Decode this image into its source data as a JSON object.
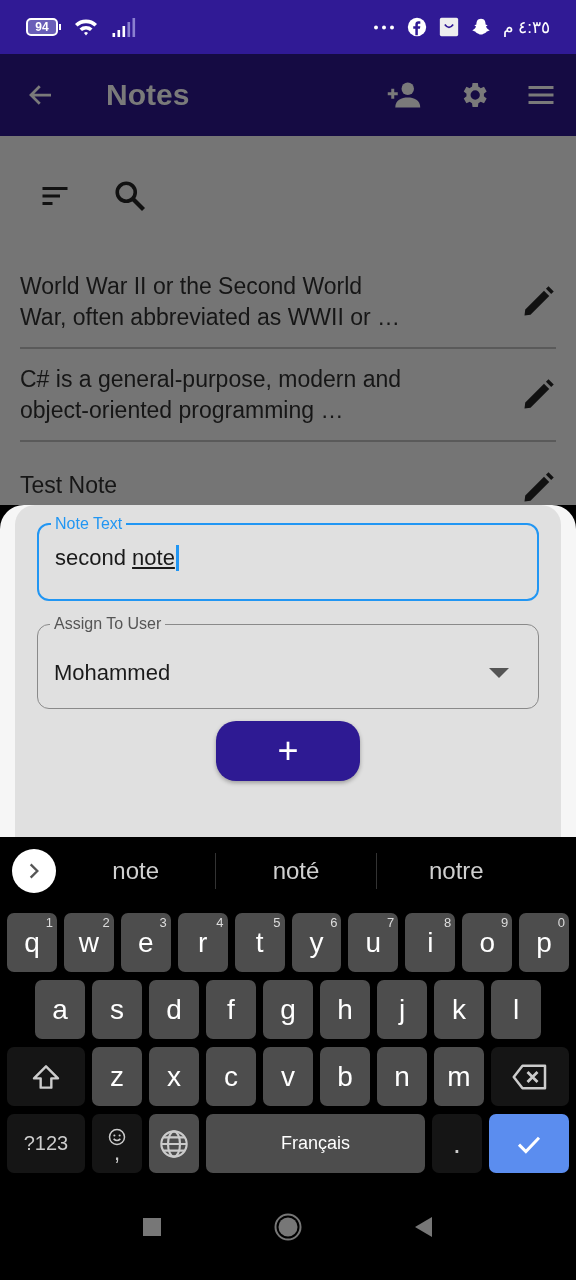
{
  "status_bar": {
    "battery": "94",
    "time": "٤:٣٥ م"
  },
  "app_bar": {
    "title": "Notes"
  },
  "notes": [
    {
      "text": "World War II or the Second World War, often abbreviated as WWII or …"
    },
    {
      "text": "C# is a general-purpose, modern and object-oriented programming …"
    },
    {
      "text": "Test Note"
    }
  ],
  "sheet": {
    "note_field": {
      "label": "Note Text",
      "value": "second note",
      "focused": true,
      "last_word_underlined": true
    },
    "user_dropdown": {
      "label": "Assign To User",
      "value": "Mohammed"
    },
    "add_button": {
      "label": "+"
    }
  },
  "keyboard": {
    "suggestions": [
      "note",
      "noté",
      "notre"
    ],
    "rows": [
      {
        "keys": [
          {
            "kind": "letter",
            "label": "q",
            "hint": "1"
          },
          {
            "kind": "letter",
            "label": "w",
            "hint": "2"
          },
          {
            "kind": "letter",
            "label": "e",
            "hint": "3"
          },
          {
            "kind": "letter",
            "label": "r",
            "hint": "4"
          },
          {
            "kind": "letter",
            "label": "t",
            "hint": "5"
          },
          {
            "kind": "letter",
            "label": "y",
            "hint": "6"
          },
          {
            "kind": "letter",
            "label": "u",
            "hint": "7"
          },
          {
            "kind": "letter",
            "label": "i",
            "hint": "8"
          },
          {
            "kind": "letter",
            "label": "o",
            "hint": "9"
          },
          {
            "kind": "letter",
            "label": "p",
            "hint": "0"
          }
        ]
      },
      {
        "keys": [
          {
            "kind": "letter",
            "label": "a"
          },
          {
            "kind": "letter",
            "label": "s"
          },
          {
            "kind": "letter",
            "label": "d"
          },
          {
            "kind": "letter",
            "label": "f"
          },
          {
            "kind": "letter",
            "label": "g"
          },
          {
            "kind": "letter",
            "label": "h"
          },
          {
            "kind": "letter",
            "label": "j"
          },
          {
            "kind": "letter",
            "label": "k"
          },
          {
            "kind": "letter",
            "label": "l"
          }
        ]
      },
      {
        "keys": [
          {
            "kind": "shift"
          },
          {
            "kind": "letter",
            "label": "z"
          },
          {
            "kind": "letter",
            "label": "x"
          },
          {
            "kind": "letter",
            "label": "c"
          },
          {
            "kind": "letter",
            "label": "v"
          },
          {
            "kind": "letter",
            "label": "b"
          },
          {
            "kind": "letter",
            "label": "n"
          },
          {
            "kind": "letter",
            "label": "m"
          },
          {
            "kind": "backspace"
          }
        ]
      },
      {
        "keys": [
          {
            "kind": "symbols",
            "label": "?123"
          },
          {
            "kind": "emoji",
            "label": ","
          },
          {
            "kind": "globe"
          },
          {
            "kind": "space",
            "label": "Français"
          },
          {
            "kind": "period",
            "label": "."
          },
          {
            "kind": "enter"
          }
        ]
      }
    ]
  }
}
